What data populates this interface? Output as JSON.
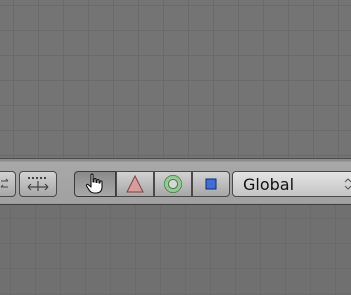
{
  "header": {
    "manipulator_buttons": [
      {
        "name": "hand-manipulator-toggle",
        "active": true
      },
      {
        "name": "translate-manipulator",
        "active": false
      },
      {
        "name": "rotate-manipulator",
        "active": false
      },
      {
        "name": "scale-manipulator",
        "active": false
      }
    ],
    "orientation_select": {
      "value": "Global"
    }
  },
  "icons": {
    "hand": "hand-pointer-icon",
    "translate": "triangle-icon",
    "rotate": "ring-icon",
    "scale": "square-icon"
  },
  "colors": {
    "translate": "#d99c9c",
    "rotate": "#7fba7f",
    "scale": "#3f6ed8"
  }
}
